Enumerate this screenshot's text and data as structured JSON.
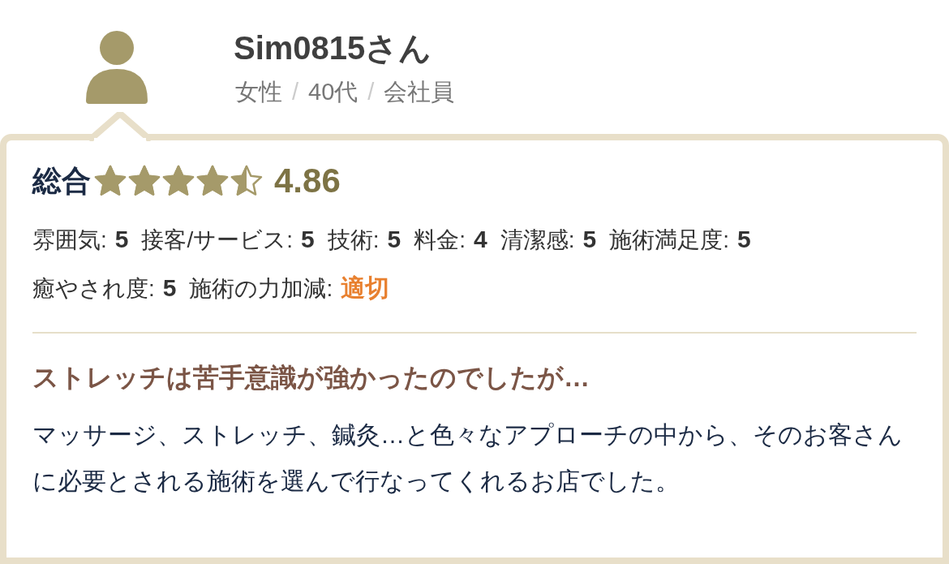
{
  "reviewer": {
    "name": "Sim0815さん",
    "details": [
      "女性",
      "40代",
      "会社員"
    ],
    "separator": "/"
  },
  "overall": {
    "label": "総合",
    "stars": 4.5,
    "score": "4.86"
  },
  "ratings": [
    {
      "kind": "score",
      "label": "雰囲気:",
      "value": "5"
    },
    {
      "kind": "score",
      "label": "接客/サービス:",
      "value": "5"
    },
    {
      "kind": "score",
      "label": "技術:",
      "value": "5"
    },
    {
      "kind": "score",
      "label": "料金:",
      "value": "4"
    },
    {
      "kind": "score",
      "label": "清潔感:",
      "value": "5"
    },
    {
      "kind": "score",
      "label": "施術満足度:",
      "value": "5"
    },
    {
      "kind": "score",
      "label": "癒やされ度:",
      "value": "5"
    },
    {
      "kind": "choice",
      "label": "施術の力加減:",
      "value": "適切"
    }
  ],
  "review": {
    "title": "ストレッチは苦手意識が強かったのでしたが…",
    "body": "マッサージ、ストレッチ、鍼灸…と色々なアプローチの中から、そのお客さんに必要とされる施術を選んで行なってくれるお店でした。"
  }
}
